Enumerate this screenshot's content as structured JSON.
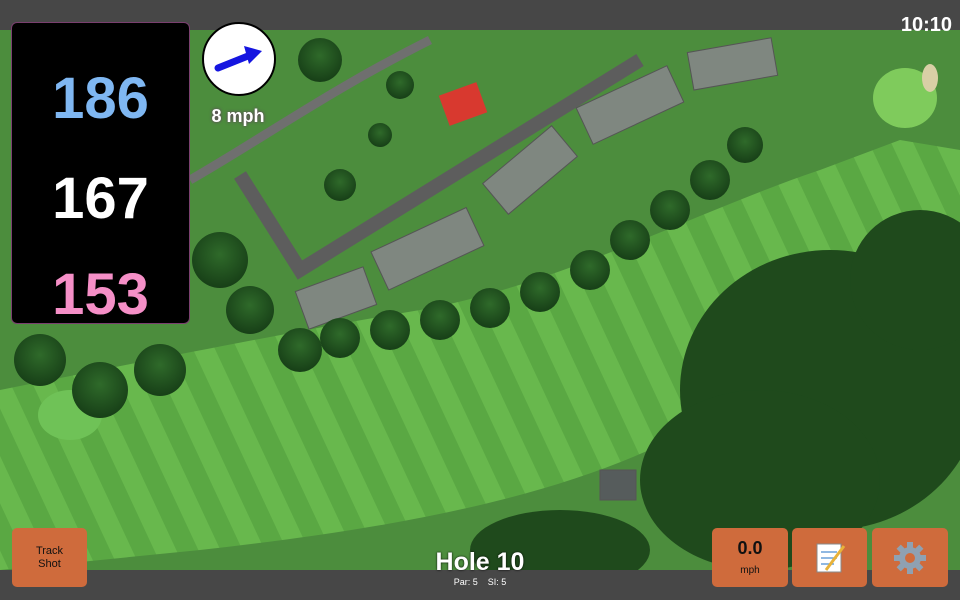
{
  "status": {
    "time": "10:10"
  },
  "distances": {
    "back": "186",
    "middle": "167",
    "front": "153"
  },
  "wind": {
    "speed_label": "8 mph",
    "icon": "arrow-right-up-icon"
  },
  "buttons": {
    "track_shot_label": "Track Shot",
    "speed_value": "0.0",
    "speed_unit": "mph",
    "notes_icon": "notepad-icon",
    "settings_icon": "gear-icon"
  },
  "hole": {
    "title": "Hole 10",
    "par_label": "Par: 5",
    "si_label": "SI: 5"
  },
  "colors": {
    "back": "#7fb7f2",
    "middle": "#ffffff",
    "front": "#f58fc7",
    "button": "#cf6b3c",
    "bars": "#474747"
  }
}
